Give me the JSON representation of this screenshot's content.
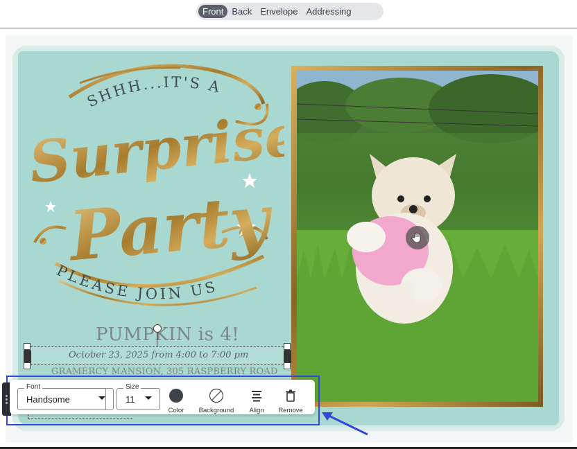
{
  "tabs": [
    {
      "label": "Front",
      "active": true
    },
    {
      "label": "Back",
      "active": false
    },
    {
      "label": "Envelope",
      "active": false
    },
    {
      "label": "Addressing",
      "active": false
    }
  ],
  "card": {
    "headline_top": "SHHH...IT'S A",
    "headline_script_1": "Surprise",
    "headline_script_2": "Party",
    "headline_bottom": "PLEASE JOIN US",
    "guest_line": "PUMPKIN is 4!",
    "date_line": "October 23, 2025 from 4:00 to 7:00 pm",
    "venue_line": "GRAMERCY MANSION, 305 RASPBERRY ROAD",
    "photo_hand_icon": "hand-grab-icon"
  },
  "toolbar": {
    "font": {
      "label": "Font",
      "value": "Handsome"
    },
    "size": {
      "label": "Size",
      "value": "11"
    },
    "color_label": "Color",
    "background_label": "Background",
    "align_label": "Align",
    "remove_label": "Remove",
    "text_color": "#3d434a"
  },
  "colors": {
    "highlight": "#3148d8",
    "mint": "#a9d8d0",
    "gold": "#b58a3a"
  }
}
